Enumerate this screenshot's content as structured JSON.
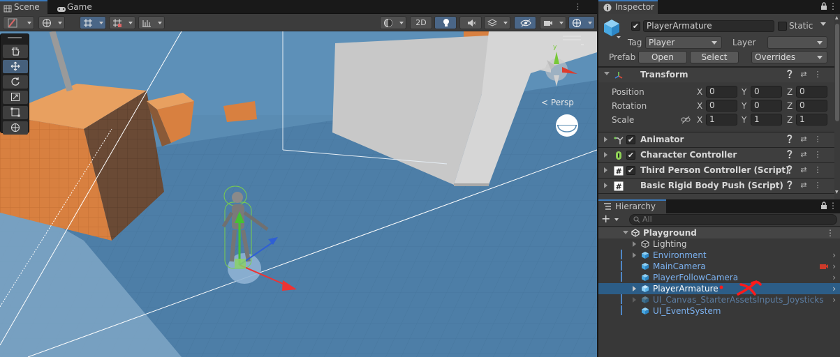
{
  "scene_panel": {
    "tabs": [
      {
        "label": "Scene",
        "active": true
      },
      {
        "label": "Game",
        "active": false
      }
    ],
    "toolbar": {
      "toggle_2d": "2D"
    },
    "tools": [
      "hand",
      "move",
      "rotate",
      "scale",
      "rect",
      "transform"
    ],
    "persp_label": "Persp"
  },
  "inspector": {
    "tab_label": "Inspector",
    "object": {
      "name": "PlayerArmature",
      "active": true,
      "static_label": "Static",
      "tag_label": "Tag",
      "tag_value": "Player",
      "layer_label": "Layer",
      "layer_value": ""
    },
    "prefab": {
      "label": "Prefab",
      "open": "Open",
      "select": "Select",
      "overrides": "Overrides"
    },
    "transform": {
      "title": "Transform",
      "rows": [
        {
          "label": "Position",
          "x": "0",
          "y": "0",
          "z": "0"
        },
        {
          "label": "Rotation",
          "x": "0",
          "y": "0",
          "z": "0"
        },
        {
          "label": "Scale",
          "x": "1",
          "y": "1",
          "z": "1"
        }
      ]
    },
    "components": [
      {
        "name": "Animator",
        "has_checkbox": true,
        "icon": "animator-icon"
      },
      {
        "name": "Character Controller",
        "has_checkbox": true,
        "icon": "character-controller-icon"
      },
      {
        "name": "Third Person Controller (Script)",
        "has_checkbox": true,
        "icon": "script-icon"
      },
      {
        "name": "Basic Rigid Body Push (Script)",
        "has_checkbox": false,
        "icon": "script-icon"
      }
    ]
  },
  "hierarchy": {
    "tab_label": "Hierarchy",
    "add_label": "+",
    "search_placeholder": "All",
    "scene_name": "Playground",
    "items": [
      {
        "label": "Lighting",
        "prefab": false,
        "expandable": true
      },
      {
        "label": "Environment",
        "prefab": true,
        "expandable": true
      },
      {
        "label": "MainCamera",
        "prefab": true,
        "expandable": false
      },
      {
        "label": "PlayerFollowCamera",
        "prefab": true,
        "expandable": false
      },
      {
        "label": "PlayerArmature",
        "prefab": true,
        "expandable": true,
        "selected": true
      },
      {
        "label": "UI_Canvas_StarterAssetsInputs_Joysticks",
        "prefab": true,
        "expandable": true,
        "dimmed": true
      },
      {
        "label": "UI_EventSystem",
        "prefab": true,
        "expandable": false
      }
    ]
  },
  "colors": {
    "accent": "#3a79bb",
    "selection": "#2c5d87",
    "prefab_text": "#7bb1ef",
    "sky": "#5b8fb6",
    "orange": "#d8823f"
  }
}
